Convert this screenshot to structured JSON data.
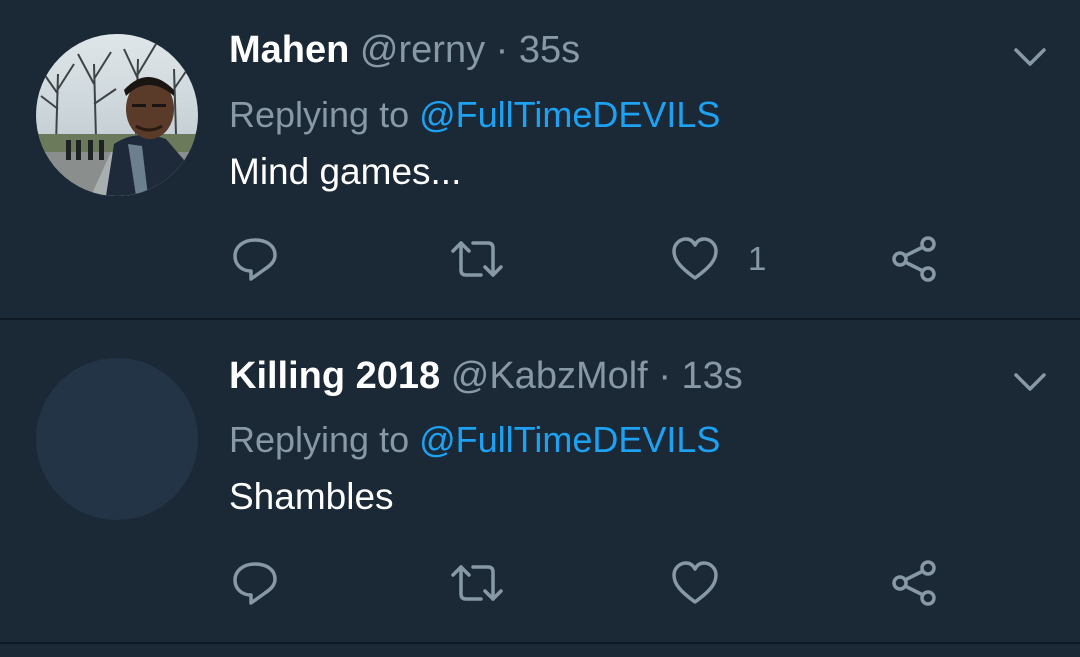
{
  "tweets": [
    {
      "display_name": "Mahen",
      "handle": "@rerny",
      "separator": "·",
      "time": "35s",
      "reply_prefix": "Replying to",
      "reply_target": "@FullTimeDEVILS",
      "text": "Mind games...",
      "like_count": "1",
      "avatar": "photo",
      "actions": [
        "reply-icon",
        "retweet-icon",
        "like-icon",
        "share-icon"
      ]
    },
    {
      "display_name": "Killing 2018",
      "handle": "@KabzMolf",
      "separator": "·",
      "time": "13s",
      "reply_prefix": "Replying to",
      "reply_target": "@FullTimeDEVILS",
      "text": "Shambles",
      "like_count": "",
      "avatar": "empty",
      "actions": [
        "reply-icon",
        "retweet-icon",
        "like-icon",
        "share-icon"
      ]
    }
  ],
  "colors": {
    "background": "#1b2836",
    "divider": "#0f1923",
    "primary_text": "#ffffff",
    "secondary_text": "#8899a6",
    "link": "#1da1f2",
    "avatar_placeholder": "#233447"
  }
}
